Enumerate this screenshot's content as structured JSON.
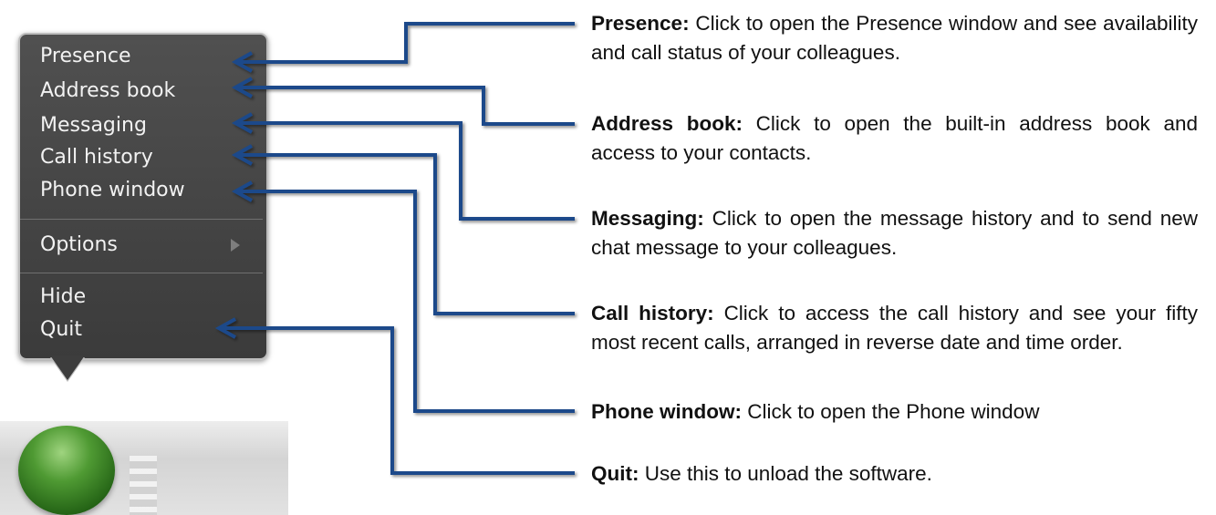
{
  "menu": {
    "items": [
      {
        "label": "Presence"
      },
      {
        "label": "Address book"
      },
      {
        "label": "Messaging"
      },
      {
        "label": "Call history"
      },
      {
        "label": "Phone window"
      }
    ],
    "options_label": "Options",
    "hide_label": "Hide",
    "quit_label": "Quit"
  },
  "descriptions": [
    {
      "term": "Presence:",
      "text": "Click to open the Presence window and see availability and call status of your colleagues."
    },
    {
      "term": "Address book:",
      "text": "Click to open the built-in address book and access to your contacts."
    },
    {
      "term": "Messaging:",
      "text": "Click to open the message history and to send new chat message to your colleagues."
    },
    {
      "term": "Call history:",
      "text": "Click to access the call history and see your fifty most recent calls, arranged in reverse date and time order."
    },
    {
      "term": "Phone window:",
      "text": "Click to open the Phone window"
    },
    {
      "term": "Quit:",
      "text": "Use this to unload the software."
    }
  ],
  "colors": {
    "arrow": "#1c4a8a",
    "menu_bg": "#424242",
    "dock_icon": "#3f8a2b"
  }
}
